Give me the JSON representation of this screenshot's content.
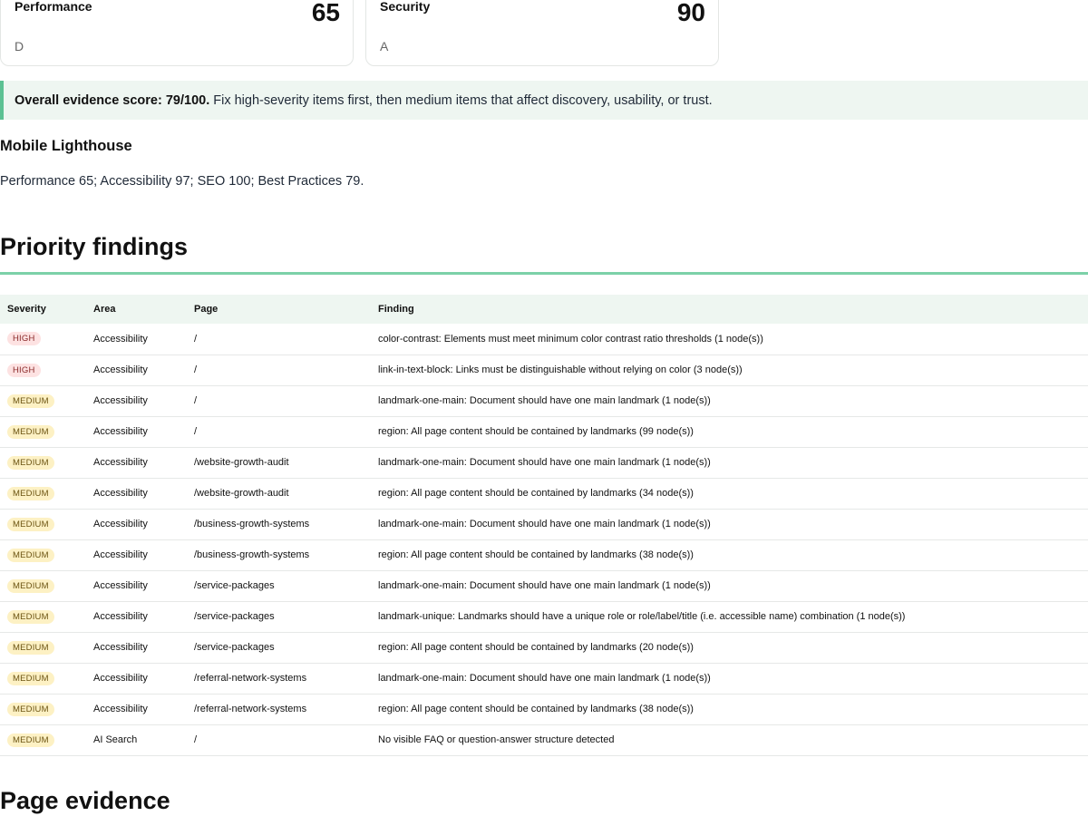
{
  "score_cards": [
    {
      "label": "Performance",
      "value": "65",
      "grade": "D"
    },
    {
      "label": "Security",
      "value": "90",
      "grade": "A"
    }
  ],
  "overall": {
    "lead": "Overall evidence score: 79/100.",
    "text": " Fix high-severity items first, then medium items that affect discovery, usability, or trust."
  },
  "mobile": {
    "heading": "Mobile Lighthouse",
    "text": "Performance 65; Accessibility 97; SEO 100; Best Practices 79."
  },
  "priority": {
    "heading": "Priority findings",
    "columns": [
      "Severity",
      "Area",
      "Page",
      "Finding"
    ],
    "rows": [
      {
        "severity": "HIGH",
        "area": "Accessibility",
        "page": "/",
        "finding": "color-contrast: Elements must meet minimum color contrast ratio thresholds (1 node(s))"
      },
      {
        "severity": "HIGH",
        "area": "Accessibility",
        "page": "/",
        "finding": "link-in-text-block: Links must be distinguishable without relying on color (3 node(s))"
      },
      {
        "severity": "MEDIUM",
        "area": "Accessibility",
        "page": "/",
        "finding": "landmark-one-main: Document should have one main landmark (1 node(s))"
      },
      {
        "severity": "MEDIUM",
        "area": "Accessibility",
        "page": "/",
        "finding": "region: All page content should be contained by landmarks (99 node(s))"
      },
      {
        "severity": "MEDIUM",
        "area": "Accessibility",
        "page": "/website-growth-audit",
        "finding": "landmark-one-main: Document should have one main landmark (1 node(s))"
      },
      {
        "severity": "MEDIUM",
        "area": "Accessibility",
        "page": "/website-growth-audit",
        "finding": "region: All page content should be contained by landmarks (34 node(s))"
      },
      {
        "severity": "MEDIUM",
        "area": "Accessibility",
        "page": "/business-growth-systems",
        "finding": "landmark-one-main: Document should have one main landmark (1 node(s))"
      },
      {
        "severity": "MEDIUM",
        "area": "Accessibility",
        "page": "/business-growth-systems",
        "finding": "region: All page content should be contained by landmarks (38 node(s))"
      },
      {
        "severity": "MEDIUM",
        "area": "Accessibility",
        "page": "/service-packages",
        "finding": "landmark-one-main: Document should have one main landmark (1 node(s))"
      },
      {
        "severity": "MEDIUM",
        "area": "Accessibility",
        "page": "/service-packages",
        "finding": "landmark-unique: Landmarks should have a unique role or role/label/title (i.e. accessible name) combination (1 node(s))"
      },
      {
        "severity": "MEDIUM",
        "area": "Accessibility",
        "page": "/service-packages",
        "finding": "region: All page content should be contained by landmarks (20 node(s))"
      },
      {
        "severity": "MEDIUM",
        "area": "Accessibility",
        "page": "/referral-network-systems",
        "finding": "landmark-one-main: Document should have one main landmark (1 node(s))"
      },
      {
        "severity": "MEDIUM",
        "area": "Accessibility",
        "page": "/referral-network-systems",
        "finding": "region: All page content should be contained by landmarks (38 node(s))"
      },
      {
        "severity": "MEDIUM",
        "area": "AI Search",
        "page": "/",
        "finding": "No visible FAQ or question-answer structure detected"
      }
    ]
  },
  "evidence": {
    "heading": "Page evidence"
  },
  "colors": {
    "high": "#fde2e2",
    "medium": "#fdf1c4",
    "accent": "#5cc193"
  }
}
